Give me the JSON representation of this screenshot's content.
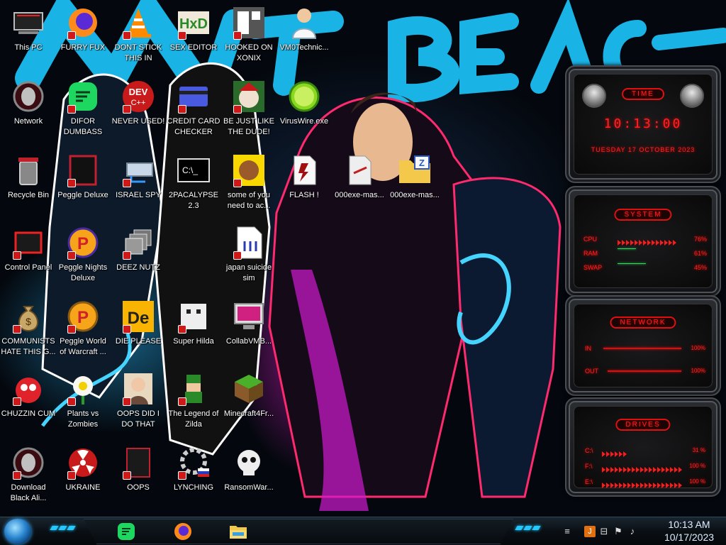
{
  "desktop": {
    "icons": [
      {
        "label": "This PC",
        "icon": "computer-icon"
      },
      {
        "label": "FURRY FUX",
        "icon": "firefox-icon"
      },
      {
        "label": "DONT STICK THIS IN YOUR...",
        "icon": "vlc-cone-icon"
      },
      {
        "label": "SEX EDITOR",
        "icon": "hex-editor-icon"
      },
      {
        "label": "HOOKED ON XONIX",
        "icon": "xonix-game-icon"
      },
      {
        "label": "VM0Technic...",
        "icon": "doctor-person-icon"
      },
      {
        "label": "Network",
        "icon": "alien-network-icon"
      },
      {
        "label": "DIFOR DUMBASS",
        "icon": "chat-app-icon"
      },
      {
        "label": "NEVER USED!",
        "icon": "dev-cpp-icon"
      },
      {
        "label": "CREDIT CARD CHECKER",
        "icon": "credit-card-icon"
      },
      {
        "label": "BE JUST LIKE THE DUDE!",
        "icon": "bonzi-face-icon"
      },
      {
        "label": "VirusWire.exe",
        "icon": "lime-icon"
      },
      {
        "label": "Recycle Bin",
        "icon": "recycle-bin-icon"
      },
      {
        "label": "Peggle Deluxe",
        "icon": "peggle-icon"
      },
      {
        "label": "ISRAEL SPY",
        "icon": "network-drive-icon"
      },
      {
        "label": "2PACALYPSE 2.3",
        "icon": "terminal-icon"
      },
      {
        "label": "some of you need to ac...",
        "icon": "beaver-icon"
      },
      {
        "label": "FLASH !",
        "icon": "flash-doc-icon"
      },
      {
        "label": "000exe-mas...",
        "icon": "exe-file-icon"
      },
      {
        "label": "000exe-mas...",
        "icon": "zip-folder-icon"
      },
      {
        "label": "Control Panel",
        "icon": "control-panel-icon"
      },
      {
        "label": "Peggle Nights Deluxe",
        "icon": "peggle-nights-icon"
      },
      {
        "label": "DEEZ NUTZ",
        "icon": "windows-stack-icon"
      },
      {
        "label": "japan suicide sim",
        "icon": "document-icon"
      },
      {
        "label": "COMMUNISTS HATE THIS G...",
        "icon": "money-bag-icon"
      },
      {
        "label": "Peggle World of Warcraft ...",
        "icon": "peggle-wow-icon"
      },
      {
        "label": "DIE PLEASE",
        "icon": "de-app-icon"
      },
      {
        "label": "Super Hilda",
        "icon": "pixel-cat-icon"
      },
      {
        "label": "CollabVMB...",
        "icon": "monitor-icon"
      },
      {
        "label": "CHUZZIN CUM",
        "icon": "chuzzle-icon"
      },
      {
        "label": "Plants vs Zombies",
        "icon": "plant-icon"
      },
      {
        "label": "OOPS DID I DO THAT",
        "icon": "portrait-icon"
      },
      {
        "label": "The Legend of Zilda",
        "icon": "pixel-hero-icon"
      },
      {
        "label": "Minecraft4Fr...",
        "icon": "grass-block-icon"
      },
      {
        "label": "Download Black Ali...",
        "icon": "alien-download-icon"
      },
      {
        "label": "UKRAINE",
        "icon": "radiation-icon"
      },
      {
        "label": "OOPS",
        "icon": "oops-icon"
      },
      {
        "label": "LYNCHING",
        "icon": "gear-flag-icon"
      },
      {
        "label": "RansomWar...",
        "icon": "skull-icon"
      }
    ]
  },
  "widgets": {
    "time": {
      "title": "TIME",
      "clock": "10:13:00",
      "date": "TUESDAY 17 OCTOBER 2023"
    },
    "system": {
      "title": "SYSTEM",
      "rows": [
        {
          "label": "CPU",
          "value": "76%",
          "fraction": 0.76
        },
        {
          "label": "RAM",
          "value": "61%",
          "fraction": 0.61
        },
        {
          "label": "SWAP",
          "value": "45%",
          "fraction": 0.45
        }
      ]
    },
    "network": {
      "title": "NETWORK",
      "rows": [
        {
          "label": "IN",
          "value": "100%"
        },
        {
          "label": "OUT",
          "value": "100%"
        }
      ]
    },
    "drives": {
      "title": "DRIVES",
      "rows": [
        {
          "label": "C:\\",
          "value": "31 %"
        },
        {
          "label": "F:\\",
          "value": "100 %"
        },
        {
          "label": "E:\\",
          "value": "100 %"
        }
      ]
    }
  },
  "taskbar": {
    "pinned": [
      {
        "name": "chat-app",
        "icon": "chat-app-icon"
      },
      {
        "name": "firefox",
        "icon": "firefox-icon"
      },
      {
        "name": "file-explorer",
        "icon": "folder-icon"
      }
    ],
    "tray": {
      "icons": [
        "tray-arrows-icon",
        "java-icon",
        "network-icon",
        "flag-icon",
        "volume-icon"
      ]
    },
    "clock": {
      "time": "10:13 AM",
      "date": "10/17/2023"
    }
  },
  "colors": {
    "accent_red": "#ff2020",
    "taskbar_cyan": "#22c8ff",
    "clock_text": "#ddeeff"
  }
}
